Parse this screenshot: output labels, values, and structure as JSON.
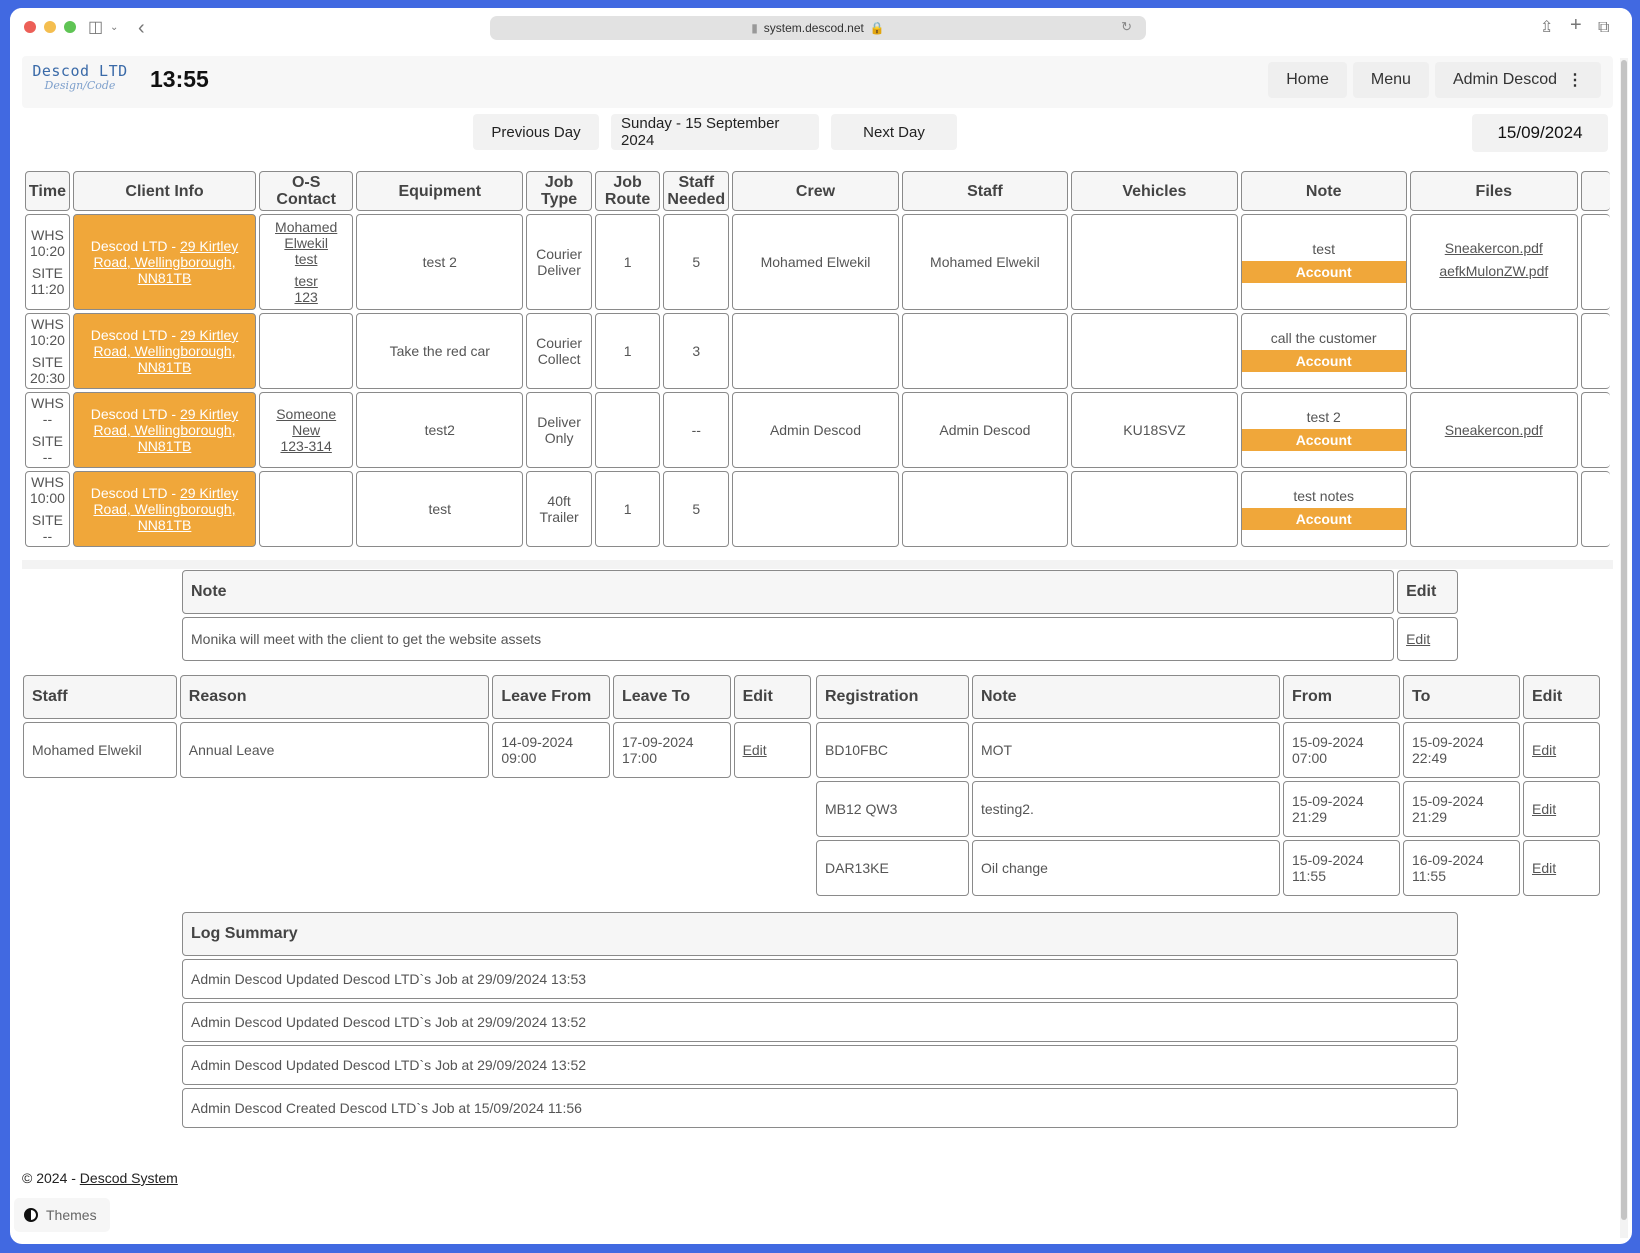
{
  "browser": {
    "url": "system.descod.net"
  },
  "header": {
    "logo_line1": "Descod LTD",
    "logo_line2": "Design/Code",
    "clock": "13:55",
    "nav": [
      "Home",
      "Menu",
      "Admin Descod"
    ]
  },
  "date_nav": {
    "prev_label": "Previous Day",
    "current_label": "Sunday - 15 September 2024",
    "next_label": "Next Day",
    "date_value": "15/09/2024"
  },
  "schedule": {
    "columns": [
      "Time",
      "Client Info",
      "O-S Contact",
      "Equipment",
      "Job Type",
      "Job Route",
      "Staff Needed",
      "Crew",
      "Staff",
      "Vehicles",
      "Note",
      "Files"
    ],
    "account_label": "Account",
    "rows": [
      {
        "whs": "10:20",
        "site": "11:20",
        "client_name": "Descod LTD - ",
        "client_addr1": "29 Kirtley",
        "client_addr2": "Road, Wellingborough,",
        "client_addr3": "NN81TB",
        "contact": [
          "Mohamed",
          "Elwekil",
          "test",
          "tesr",
          "123"
        ],
        "equipment": "test 2",
        "job_type": [
          "Courier",
          "Deliver"
        ],
        "job_route": "1",
        "staff_needed": "5",
        "crew": "Mohamed Elwekil",
        "staff": "Mohamed Elwekil",
        "vehicles": "",
        "note": "test",
        "files": [
          "Sneakercon.pdf",
          "aefkMulonZW.pdf"
        ]
      },
      {
        "whs": "10:20",
        "site": "20:30",
        "client_name": "Descod LTD - ",
        "client_addr1": "29 Kirtley",
        "client_addr2": "Road, Wellingborough,",
        "client_addr3": "NN81TB",
        "contact": [],
        "equipment": "Take the red car",
        "job_type": [
          "Courier",
          "Collect"
        ],
        "job_route": "1",
        "staff_needed": "3",
        "crew": "",
        "staff": "",
        "vehicles": "",
        "note": "call the customer",
        "files": []
      },
      {
        "whs": "--",
        "site": "--",
        "client_name": "Descod LTD - ",
        "client_addr1": "29 Kirtley",
        "client_addr2": "Road, Wellingborough,",
        "client_addr3": "NN81TB",
        "contact": [
          "Someone",
          "New",
          "123-314"
        ],
        "equipment": "test2",
        "job_type": [
          "Deliver",
          "Only"
        ],
        "job_route": "",
        "staff_needed": "--",
        "crew": "Admin Descod",
        "staff": "Admin Descod",
        "vehicles": "KU18SVZ",
        "note": "test 2",
        "files": [
          "Sneakercon.pdf"
        ]
      },
      {
        "whs": "10:00",
        "site": "--",
        "client_name": "Descod LTD - ",
        "client_addr1": "29 Kirtley",
        "client_addr2": "Road, Wellingborough,",
        "client_addr3": "NN81TB",
        "contact": [],
        "equipment": "test",
        "job_type": [
          "40ft",
          "Trailer"
        ],
        "job_route": "1",
        "staff_needed": "5",
        "crew": "",
        "staff": "",
        "vehicles": "",
        "note": "test notes",
        "files": []
      }
    ],
    "whs_label": "WHS",
    "site_label": "SITE"
  },
  "day_note": {
    "headers": [
      "Note",
      "Edit"
    ],
    "text": "Monika will meet with the client to get the website assets",
    "edit_label": "Edit"
  },
  "leave": {
    "headers": [
      "Staff",
      "Reason",
      "Leave From",
      "Leave To",
      "Edit"
    ],
    "rows": [
      {
        "staff": "Mohamed Elwekil",
        "reason": "Annual Leave",
        "from_date": "14-09-2024",
        "from_time": "09:00",
        "to_date": "17-09-2024",
        "to_time": "17:00",
        "edit": "Edit"
      }
    ]
  },
  "vehicle_off": {
    "headers": [
      "Registration",
      "Note",
      "From",
      "To",
      "Edit"
    ],
    "rows": [
      {
        "reg": "BD10FBC",
        "note": "MOT",
        "from_date": "15-09-2024",
        "from_time": "07:00",
        "to_date": "15-09-2024",
        "to_time": "22:49",
        "edit": "Edit"
      },
      {
        "reg": "MB12 QW3",
        "note": "testing2.",
        "from_date": "15-09-2024",
        "from_time": "21:29",
        "to_date": "15-09-2024",
        "to_time": "21:29",
        "edit": "Edit"
      },
      {
        "reg": "DAR13KE",
        "note": "Oil change",
        "from_date": "15-09-2024",
        "from_time": "11:55",
        "to_date": "16-09-2024",
        "to_time": "11:55",
        "edit": "Edit"
      }
    ]
  },
  "log": {
    "title": "Log Summary",
    "entries": [
      "Admin Descod Updated Descod LTD`s Job at 29/09/2024 13:53",
      "Admin Descod Updated Descod LTD`s Job at 29/09/2024 13:52",
      "Admin Descod Updated Descod LTD`s Job at 29/09/2024 13:52",
      "Admin Descod Created Descod LTD`s Job at 15/09/2024 11:56"
    ]
  },
  "footer": {
    "copyright": "© 2024 - ",
    "link": "Descod System",
    "themes_label": "Themes"
  },
  "colors": {
    "accent": "#f0a73a",
    "frame": "#4169e1"
  }
}
